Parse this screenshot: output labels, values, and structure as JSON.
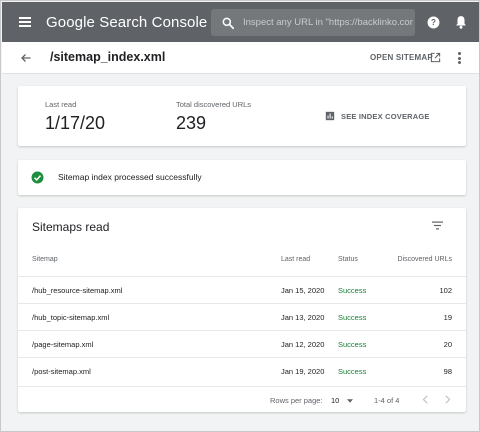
{
  "appbar": {
    "title": "Google Search Console",
    "search_placeholder": "Inspect any URL in \"https://backlinko.com/\""
  },
  "subheader": {
    "page_title": "/sitemap_index.xml",
    "open_sitemap_label": "OPEN SITEMAP"
  },
  "stats": {
    "last_read_label": "Last read",
    "last_read_value": "1/17/20",
    "total_urls_label": "Total discovered URLs",
    "total_urls_value": "239",
    "coverage_label": "SEE INDEX COVERAGE"
  },
  "status": {
    "message": "Sitemap index processed successfully"
  },
  "table": {
    "title": "Sitemaps read",
    "columns": [
      "Sitemap",
      "Last read",
      "Status",
      "Discovered URLs"
    ],
    "rows": [
      [
        "/hub_resource-sitemap.xml",
        "Jan 15, 2020",
        "Success",
        "102"
      ],
      [
        "/hub_topic-sitemap.xml",
        "Jan 13, 2020",
        "Success",
        "19"
      ],
      [
        "/page-sitemap.xml",
        "Jan 12, 2020",
        "Success",
        "20"
      ],
      [
        "/post-sitemap.xml",
        "Jan 19, 2020",
        "Success",
        "98"
      ]
    ],
    "pager": {
      "rows_per_page_label": "Rows per page:",
      "rows_per_page_value": "10",
      "range": "1-4 of 4"
    }
  },
  "colors": {
    "appbar": "#5f6368",
    "success": "#188038",
    "check": "#1e8e3e"
  },
  "icons": {
    "menu": "menu-icon",
    "search": "search-icon",
    "help": "help-icon",
    "notifications": "bell-icon",
    "back": "back-arrow-icon",
    "open": "open-in-new-icon",
    "more": "more-vert-icon",
    "coverage": "bar-chart-icon",
    "status": "check-circle-icon",
    "filter": "filter-icon"
  }
}
